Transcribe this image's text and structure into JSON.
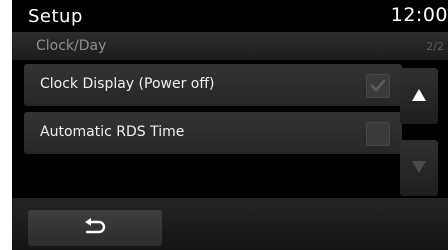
{
  "header": {
    "title": "Setup",
    "time": "12:00"
  },
  "subheader": {
    "title": "Clock/Day",
    "page_indicator": "2/2"
  },
  "settings": [
    {
      "label": "Clock Display (Power off)",
      "checked": true
    },
    {
      "label": "Automatic RDS Time",
      "checked": false
    }
  ],
  "scroll": {
    "up_icon": "triangle-up-icon",
    "down_icon": "triangle-down-icon",
    "up_enabled": true,
    "down_enabled": false
  },
  "footer": {
    "back_icon": "back-arrow-icon"
  },
  "colors": {
    "background": "#000000",
    "row": "#2e2e2e",
    "text": "#f0f0f0",
    "subtext": "#8e8e8e"
  }
}
